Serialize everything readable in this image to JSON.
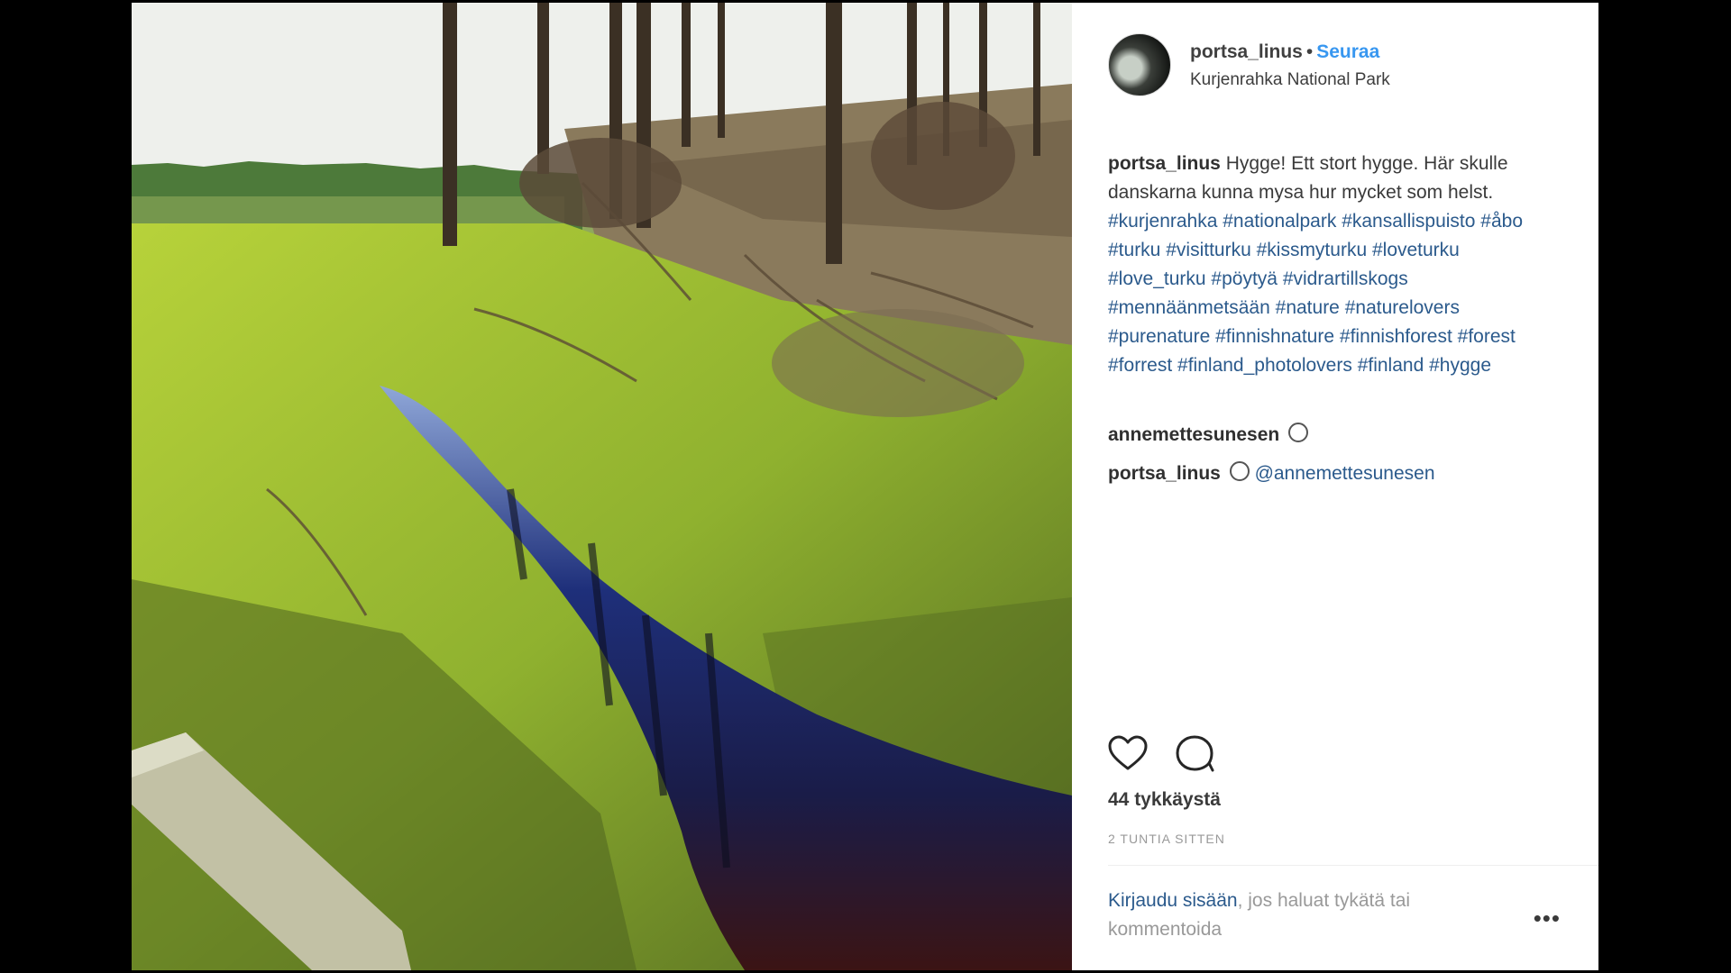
{
  "post": {
    "username": "portsa_linus",
    "follow_label": "Seuraa",
    "location": "Kurjenrahka National Park",
    "caption_text": "Hygge! Ett stort hygge. Här skulle danskarna kunna mysa hur mycket som helst.",
    "hashtags": [
      "#kurjenrahka",
      "#nationalpark",
      "#kansallispuisto",
      "#åbo",
      "#turku",
      "#visitturku",
      "#kissmyturku",
      "#loveturku",
      "#love_turku",
      "#pöytyä",
      "#vidrartillskogs",
      "#mennäänmetsään",
      "#nature",
      "#naturelovers",
      "#purenature",
      "#finnishnature",
      "#finnishforest",
      "#forest",
      "#forrest",
      "#finland_photolovers",
      "#finland",
      "#hygge"
    ],
    "comments": [
      {
        "user": "annemettesunesen",
        "text": "",
        "mention": ""
      },
      {
        "user": "portsa_linus",
        "text": "",
        "mention": "@annemettesunesen"
      }
    ],
    "likes_label": "44 tykkäystä",
    "time_label": "2 TUNTIA SITTEN",
    "login_link": "Kirjaudu sisään",
    "login_rest": ", jos haluat tykätä tai kommentoida",
    "more_label": "•••"
  },
  "icons": {
    "like": "heart-icon",
    "comment": "comment-icon",
    "emoji": "smiley-emoji-icon"
  },
  "colors": {
    "follow": "#3897f0",
    "hashtag": "#2b5a8c",
    "muted": "#999999"
  }
}
